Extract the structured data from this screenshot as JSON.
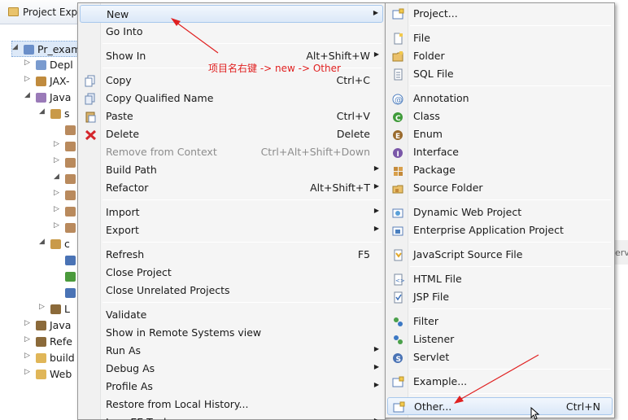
{
  "explorer": {
    "title": "Project Exp",
    "rows": [
      {
        "label": "Pr_exam",
        "twisty": "◢",
        "icon_color": "#6b8fc9",
        "selected": true
      },
      {
        "label": "Depl",
        "twisty": "▷",
        "icon_color": "#7a9bcf",
        "selected": false
      },
      {
        "label": "JAX-",
        "twisty": "▷",
        "icon_color": "#c08b3e",
        "selected": false
      },
      {
        "label": "Java",
        "twisty": "◢",
        "icon_color": "#9a7ab8",
        "selected": false
      },
      {
        "label": "s",
        "twisty": "◢",
        "icon_color": "#c99a49",
        "selected": false
      },
      {
        "label": "",
        "twisty": "",
        "icon_color": "#b98a5d",
        "selected": false
      },
      {
        "label": "",
        "twisty": "▷",
        "icon_color": "#b98a5d",
        "selected": false
      },
      {
        "label": "",
        "twisty": "▷",
        "icon_color": "#b98a5d",
        "selected": false
      },
      {
        "label": "",
        "twisty": "◢",
        "icon_color": "#b98a5d",
        "selected": false
      },
      {
        "label": "",
        "twisty": "▷",
        "icon_color": "#b98a5d",
        "selected": false
      },
      {
        "label": "",
        "twisty": "▷",
        "icon_color": "#b98a5d",
        "selected": false
      },
      {
        "label": "",
        "twisty": "▷",
        "icon_color": "#b98a5d",
        "selected": false
      },
      {
        "label": "c",
        "twisty": "◢",
        "icon_color": "#c99a49",
        "selected": false
      },
      {
        "label": "",
        "twisty": "",
        "icon_color": "#4a73b5",
        "selected": false
      },
      {
        "label": "",
        "twisty": "",
        "icon_color": "#4b9a3c",
        "selected": false
      },
      {
        "label": "",
        "twisty": "",
        "icon_color": "#4a73b5",
        "selected": false
      },
      {
        "label": "L",
        "twisty": "▷",
        "icon_color": "#8b6a3a",
        "selected": false
      },
      {
        "label": "Java",
        "twisty": "▷",
        "icon_color": "#8b6a3a",
        "selected": false
      },
      {
        "label": "Refe",
        "twisty": "▷",
        "icon_color": "#8b6a3a",
        "selected": false
      },
      {
        "label": "build",
        "twisty": "▷",
        "icon_color": "#e0b658",
        "selected": false
      },
      {
        "label": "Web",
        "twisty": "▷",
        "icon_color": "#e0b658",
        "selected": false
      }
    ],
    "side_panel_text": "erv"
  },
  "context_menu": {
    "items": [
      {
        "label": "New",
        "shortcut": "",
        "submenu": true,
        "icon": "",
        "disabled": false,
        "hover": true
      },
      {
        "label": "Go Into",
        "shortcut": "",
        "submenu": false,
        "icon": "",
        "disabled": false
      },
      {
        "sep": true
      },
      {
        "label": "Show In",
        "shortcut": "Alt+Shift+W",
        "submenu": true,
        "icon": "",
        "disabled": false
      },
      {
        "sep": true
      },
      {
        "label": "Copy",
        "shortcut": "Ctrl+C",
        "submenu": false,
        "icon": "copy-icon",
        "disabled": false
      },
      {
        "label": "Copy Qualified Name",
        "shortcut": "",
        "submenu": false,
        "icon": "copy-qualified-icon",
        "disabled": false
      },
      {
        "label": "Paste",
        "shortcut": "Ctrl+V",
        "submenu": false,
        "icon": "paste-icon",
        "disabled": false
      },
      {
        "label": "Delete",
        "shortcut": "Delete",
        "submenu": false,
        "icon": "delete-icon",
        "disabled": false
      },
      {
        "label": "Remove from Context",
        "shortcut": "Ctrl+Alt+Shift+Down",
        "submenu": false,
        "icon": "",
        "disabled": true
      },
      {
        "label": "Build Path",
        "shortcut": "",
        "submenu": true,
        "icon": "",
        "disabled": false
      },
      {
        "label": "Refactor",
        "shortcut": "Alt+Shift+T",
        "submenu": true,
        "icon": "",
        "disabled": false
      },
      {
        "sep": true
      },
      {
        "label": "Import",
        "shortcut": "",
        "submenu": true,
        "icon": "",
        "disabled": false
      },
      {
        "label": "Export",
        "shortcut": "",
        "submenu": true,
        "icon": "",
        "disabled": false
      },
      {
        "sep": true
      },
      {
        "label": "Refresh",
        "shortcut": "F5",
        "submenu": false,
        "icon": "",
        "disabled": false
      },
      {
        "label": "Close Project",
        "shortcut": "",
        "submenu": false,
        "icon": "",
        "disabled": false
      },
      {
        "label": "Close Unrelated Projects",
        "shortcut": "",
        "submenu": false,
        "icon": "",
        "disabled": false
      },
      {
        "sep": true
      },
      {
        "label": "Validate",
        "shortcut": "",
        "submenu": false,
        "icon": "",
        "disabled": false
      },
      {
        "label": "Show in Remote Systems view",
        "shortcut": "",
        "submenu": false,
        "icon": "",
        "disabled": false
      },
      {
        "label": "Run As",
        "shortcut": "",
        "submenu": true,
        "icon": "",
        "disabled": false
      },
      {
        "label": "Debug As",
        "shortcut": "",
        "submenu": true,
        "icon": "",
        "disabled": false
      },
      {
        "label": "Profile As",
        "shortcut": "",
        "submenu": true,
        "icon": "",
        "disabled": false
      },
      {
        "label": "Restore from Local History...",
        "shortcut": "",
        "submenu": false,
        "icon": "",
        "disabled": false
      },
      {
        "label": "Java EE Tools",
        "shortcut": "",
        "submenu": true,
        "icon": "",
        "disabled": false
      }
    ]
  },
  "new_submenu": {
    "items": [
      {
        "label": "Project...",
        "shortcut": "",
        "icon": "project-icon"
      },
      {
        "sep": true
      },
      {
        "label": "File",
        "shortcut": "",
        "icon": "file-icon"
      },
      {
        "label": "Folder",
        "shortcut": "",
        "icon": "folder-icon"
      },
      {
        "label": "SQL File",
        "shortcut": "",
        "icon": "sql-file-icon"
      },
      {
        "sep": true
      },
      {
        "label": "Annotation",
        "shortcut": "",
        "icon": "annotation-icon"
      },
      {
        "label": "Class",
        "shortcut": "",
        "icon": "class-icon"
      },
      {
        "label": "Enum",
        "shortcut": "",
        "icon": "enum-icon"
      },
      {
        "label": "Interface",
        "shortcut": "",
        "icon": "interface-icon"
      },
      {
        "label": "Package",
        "shortcut": "",
        "icon": "package-icon"
      },
      {
        "label": "Source Folder",
        "shortcut": "",
        "icon": "source-folder-icon"
      },
      {
        "sep": true
      },
      {
        "label": "Dynamic Web Project",
        "shortcut": "",
        "icon": "web-project-icon"
      },
      {
        "label": "Enterprise Application Project",
        "shortcut": "",
        "icon": "ear-project-icon"
      },
      {
        "sep": true
      },
      {
        "label": "JavaScript Source File",
        "shortcut": "",
        "icon": "javascript-file-icon"
      },
      {
        "sep": true
      },
      {
        "label": "HTML File",
        "shortcut": "",
        "icon": "html-file-icon"
      },
      {
        "label": "JSP File",
        "shortcut": "",
        "icon": "jsp-file-icon"
      },
      {
        "sep": true
      },
      {
        "label": "Filter",
        "shortcut": "",
        "icon": "filter-icon"
      },
      {
        "label": "Listener",
        "shortcut": "",
        "icon": "listener-icon"
      },
      {
        "label": "Servlet",
        "shortcut": "",
        "icon": "servlet-icon"
      },
      {
        "sep": true
      },
      {
        "label": "Example...",
        "shortcut": "",
        "icon": "example-icon"
      },
      {
        "sep": true
      },
      {
        "label": "Other...",
        "shortcut": "Ctrl+N",
        "icon": "other-icon",
        "hover": true
      }
    ]
  },
  "annotation": {
    "text": "项目名右键 -> new -> Other",
    "color": "#e02020"
  }
}
